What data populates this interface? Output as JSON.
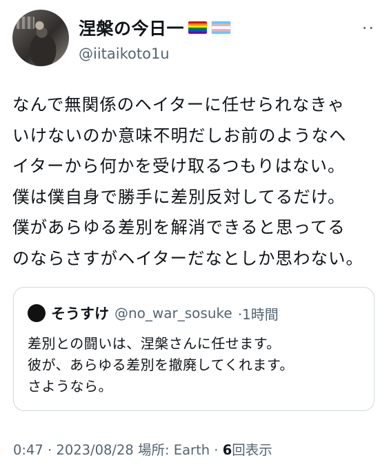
{
  "author": {
    "display_name": "涅槃の今日一",
    "handle": "@iitaikoto1u",
    "flags": [
      "rainbow-flag-icon",
      "transgender-flag-icon"
    ]
  },
  "tweet": {
    "lines": [
      "なんで無関係のヘイターに任せられなきゃ",
      "いけないのか意味不明だしお前のようなヘ",
      "イターから何かを受け取るつもりはない。",
      "僕は僕自身で勝手に差別反対してるだけ。",
      "僕があらゆる差別を解消できると思ってる",
      "のならさすがヘイターだなとしか思わない。"
    ]
  },
  "quoted": {
    "display_name": "そうすけ",
    "handle": "@no_war_sosuke",
    "time": "·1時間",
    "lines": [
      "差別との闘いは、涅槃さんに任せます。",
      "彼が、あらゆる差別を撤廃してくれます。",
      "さようなら。"
    ]
  },
  "meta": {
    "time": "0:47",
    "sep1": " · ",
    "date": "2023/08/28",
    "location": " 場所: Earth",
    "sep2": " · ",
    "views_count": "6",
    "views_label": "回表示"
  },
  "more_label": "··"
}
